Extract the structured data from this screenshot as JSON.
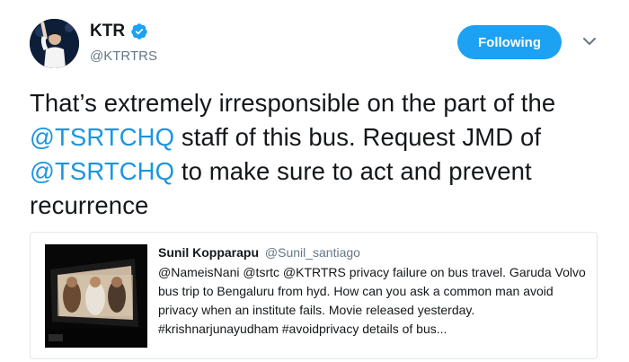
{
  "author": {
    "name": "KTR",
    "handle": "@KTRTRS",
    "verified": true
  },
  "follow_button": {
    "label": "Following",
    "color": "#1da1f2"
  },
  "tweet": {
    "segments": [
      {
        "text": "That’s extremely irresponsible on the part of the ",
        "type": "text"
      },
      {
        "text": "@TSRTCHQ",
        "type": "mention"
      },
      {
        "text": " staff of this bus. Request JMD of ",
        "type": "text"
      },
      {
        "text": "@TSRTCHQ",
        "type": "mention"
      },
      {
        "text": " to make sure to act and prevent recurrence",
        "type": "text"
      }
    ],
    "mention_color": "#1b95e0"
  },
  "quoted_tweet": {
    "name": "Sunil Kopparapu",
    "handle": "@Sunil_santiago",
    "text": "@NameisNani @tsrtc @KTRTRS privacy failure on bus travel. Garuda Volvo bus trip to Bengaluru from hyd. How can you ask a common man avoid privacy when an institute fails. Movie released yesterday. #krishnarjunayudham #avoidprivacy details of bus...",
    "media": "bus-video-screen-thumbnail"
  },
  "icons": {
    "verified": "verified-badge-icon",
    "caret": "chevron-down-icon"
  }
}
